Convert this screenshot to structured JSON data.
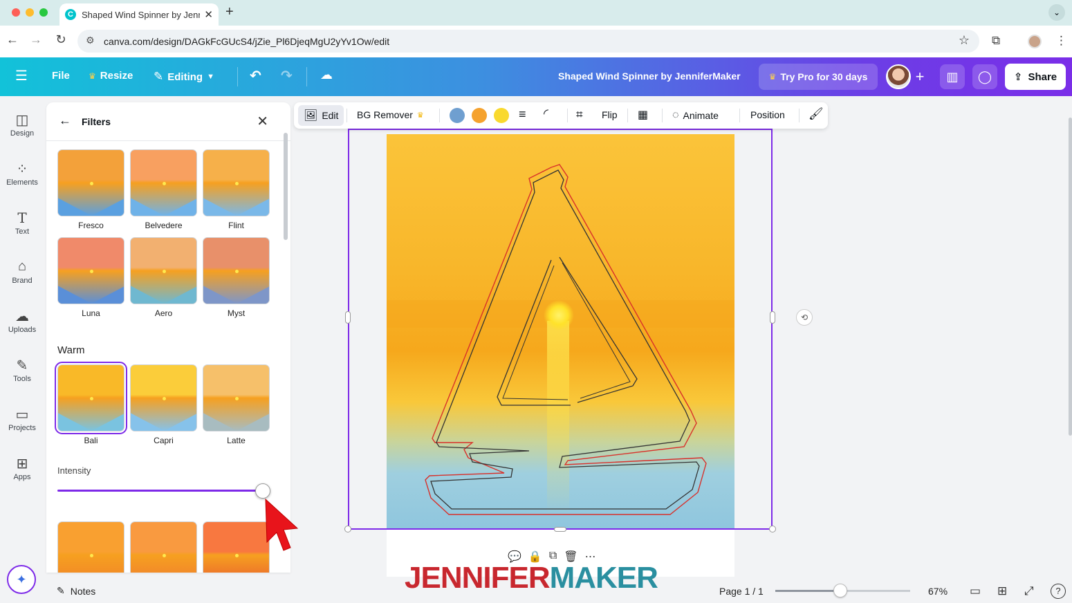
{
  "browser": {
    "tab_title": "Shaped Wind Spinner by Jenn",
    "tab_favicon": "C",
    "url": "canva.com/design/DAGkFcGUcS4/jZie_Pl6DjeqMgU2yYv1Ow/edit",
    "traffic_colors": [
      "#fe5f57",
      "#febc2e",
      "#28c840"
    ]
  },
  "header": {
    "file_label": "File",
    "resize_label": "Resize",
    "editing_label": "Editing",
    "doc_title": "Shaped Wind Spinner by JenniferMaker",
    "try_pro_label": "Try Pro for 30 days",
    "share_label": "Share"
  },
  "rail": {
    "items": [
      {
        "label": "Design",
        "icon": "design-icon"
      },
      {
        "label": "Elements",
        "icon": "elements-icon"
      },
      {
        "label": "Text",
        "icon": "text-icon"
      },
      {
        "label": "Brand",
        "icon": "brand-icon"
      },
      {
        "label": "Uploads",
        "icon": "uploads-icon"
      },
      {
        "label": "Tools",
        "icon": "tools-icon"
      },
      {
        "label": "Projects",
        "icon": "projects-icon"
      },
      {
        "label": "Apps",
        "icon": "apps-icon"
      }
    ]
  },
  "filters": {
    "title": "Filters",
    "row1": [
      {
        "label": "Fresco",
        "top": "#f3a13a",
        "bottom": "#5aa0e0"
      },
      {
        "label": "Belvedere",
        "top": "#f8a060",
        "bottom": "#6fb2e8"
      },
      {
        "label": "Flint",
        "top": "#f6b04a",
        "bottom": "#7ab8e8"
      }
    ],
    "row2": [
      {
        "label": "Luna",
        "top": "#f08a6a",
        "bottom": "#5a8fd8"
      },
      {
        "label": "Aero",
        "top": "#f2b070",
        "bottom": "#6fb8d0"
      },
      {
        "label": "Myst",
        "top": "#e8906a",
        "bottom": "#7e96c8"
      }
    ],
    "warm_title": "Warm",
    "warm": [
      {
        "label": "Bali",
        "top": "#f9b928",
        "bottom": "#7ac3e0"
      },
      {
        "label": "Capri",
        "top": "#fbcd3a",
        "bottom": "#86c2ea"
      },
      {
        "label": "Latte",
        "top": "#f6c06a",
        "bottom": "#a8bcc0"
      }
    ],
    "intensity_label": "Intensity",
    "intensity_value": 100,
    "row4": [
      {
        "top": "#f9a030",
        "bottom": "#f0802a"
      },
      {
        "top": "#f99a40",
        "bottom": "#ef7a30"
      },
      {
        "top": "#f87840",
        "bottom": "#e85a30"
      }
    ]
  },
  "toolbar": {
    "edit_label": "Edit",
    "bg_remover_label": "BG Remover",
    "swatches": [
      "#6f9fd0",
      "#f5a22e",
      "#f9d92e"
    ],
    "flip_label": "Flip",
    "animate_label": "Animate",
    "position_label": "Position"
  },
  "watermark": {
    "part1": "JENNIFER",
    "part2": "MAKER",
    "color1": "#c8272e",
    "color2": "#2a8fa0"
  },
  "bottom": {
    "notes_label": "Notes",
    "page_info": "Page 1 / 1",
    "zoom": "67%",
    "zoom_fraction": 0.43
  },
  "colors": {
    "accent": "#7d2ae8"
  }
}
